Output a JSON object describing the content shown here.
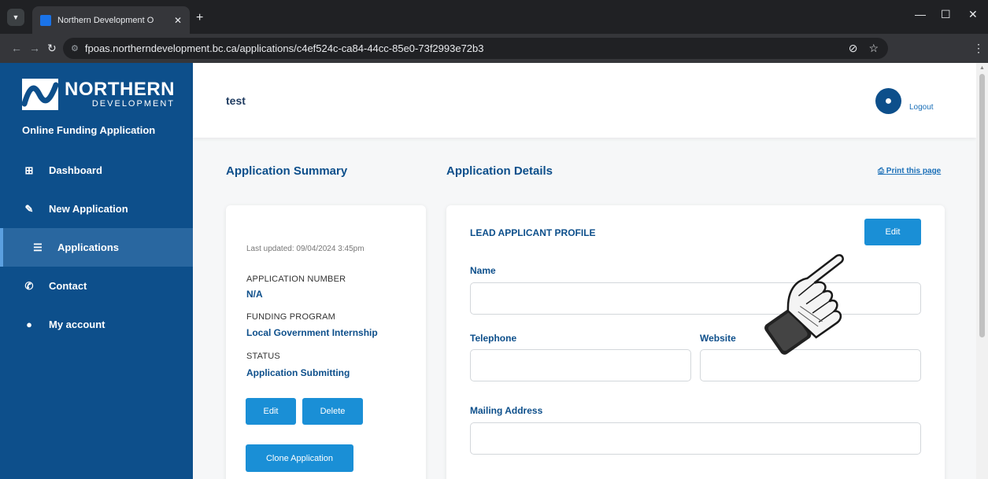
{
  "browser": {
    "tab_title": "Northern Development O",
    "url": "fpoas.northerndevelopment.bc.ca/applications/c4ef524c-ca84-44cc-85e0-73f2993e72b3"
  },
  "sidebar": {
    "logo_line1": "NORTHERN",
    "logo_line2": "DEVELOPMENT",
    "app_name": "Online Funding Application",
    "items": [
      {
        "label": "Dashboard",
        "icon": "grid-icon"
      },
      {
        "label": "New Application",
        "icon": "pencil-icon"
      },
      {
        "label": "Applications",
        "icon": "list-icon"
      },
      {
        "label": "Contact",
        "icon": "phone-icon"
      },
      {
        "label": "My account",
        "icon": "user-icon"
      }
    ]
  },
  "header": {
    "title": "test",
    "logout_label": "Logout"
  },
  "summary": {
    "heading": "Application Summary",
    "last_updated": "Last updated: 09/04/2024 3:45pm",
    "app_number_label": "APPLICATION NUMBER",
    "app_number_value": "N/A",
    "program_label": "FUNDING PROGRAM",
    "program_value": "Local Government Internship",
    "status_label": "STATUS",
    "status_value": "Application Submitting",
    "edit_label": "Edit",
    "delete_label": "Delete",
    "clone_label": "Clone Application"
  },
  "details": {
    "heading": "Application Details",
    "print_label": "Print this page",
    "profile_heading": "LEAD APPLICANT PROFILE",
    "edit_label": "Edit",
    "name_label": "Name",
    "telephone_label": "Telephone",
    "website_label": "Website",
    "mailing_label": "Mailing Address",
    "name_value": "",
    "telephone_value": "",
    "website_value": "",
    "mailing_value": ""
  },
  "colors": {
    "sidebar": "#0d4f8b",
    "accent": "#1a8fd6",
    "heading": "#0d4f8b"
  }
}
